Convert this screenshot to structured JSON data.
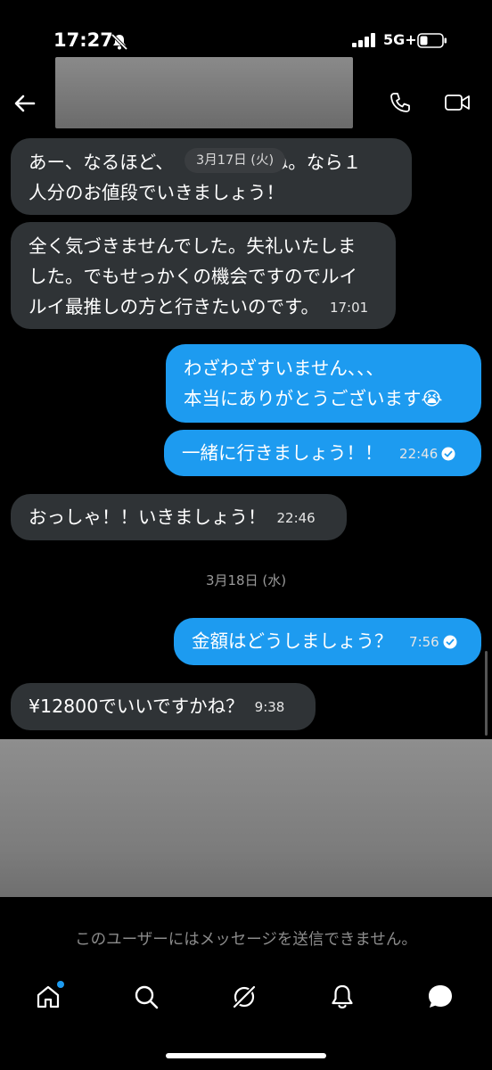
{
  "status_bar": {
    "time": "17:27",
    "network": "5G+"
  },
  "header": {
    "contact_name": ""
  },
  "floating_date": "3月17日 (火)",
  "messages": [
    {
      "side": "in",
      "text_line1": "あー、なるほど、",
      "text_line1_tail": "ね。なら１",
      "text_line2": "人分のお値段でいきましょう！"
    },
    {
      "side": "in",
      "text_line1": "全く気づきませんでした。失礼いたしま",
      "text_line2": "した。でもせっかくの機会ですのでルイ",
      "text_line3": "ルイ最推しの方と行きたいのです。",
      "time": "17:01"
    },
    {
      "side": "out",
      "text_line1": "わざわざすいません、、、",
      "text_line2": "本当にありがとうございます😭"
    },
    {
      "side": "out",
      "text": "一緒に行きましょう！！",
      "time": "22:46"
    },
    {
      "side": "in",
      "text": "おっしゃ！！いきましょう！",
      "time": "22:46"
    },
    {
      "side": "out",
      "text": "金額はどうしましょう？",
      "time": "7:56"
    },
    {
      "side": "in",
      "text": "¥12800でいいですかね？",
      "time": "9:38"
    }
  ],
  "date_separator": "3月18日 (水)",
  "footer_notice": "このユーザーにはメッセージを送信できません。",
  "nav": [
    {
      "icon": "home-icon",
      "active": true
    },
    {
      "icon": "search-icon"
    },
    {
      "icon": "grok-icon"
    },
    {
      "icon": "notifications-icon"
    },
    {
      "icon": "messages-icon",
      "active": true
    }
  ],
  "colors": {
    "accent": "#1d9bf0",
    "incoming_bubble": "#2f3336",
    "background": "#000000"
  }
}
